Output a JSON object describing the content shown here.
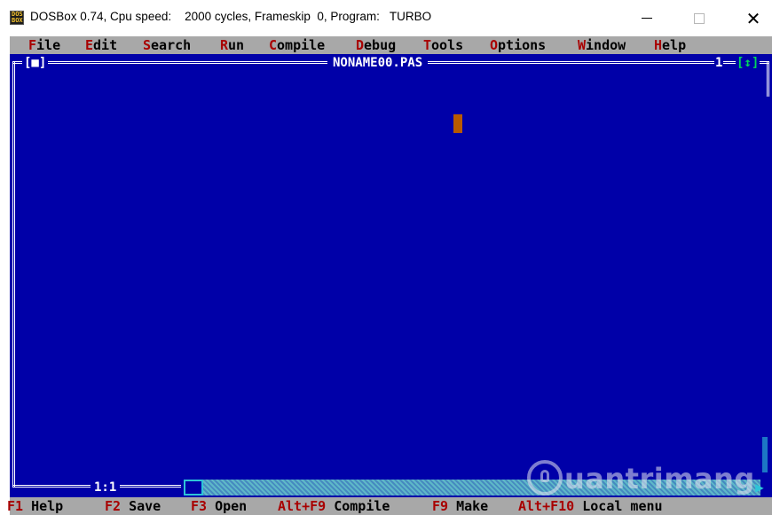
{
  "window": {
    "title": "DOSBox 0.74, Cpu speed:    2000 cycles, Frameskip  0, Program:   TURBO",
    "icon_text": "DOS\nBOX",
    "minimize_icon": "minimize-icon",
    "maximize_icon": "maximize-icon",
    "close_icon": "close-icon",
    "close_glyph": "✕"
  },
  "menu": {
    "items": [
      {
        "hotkey": "F",
        "rest": "ile"
      },
      {
        "hotkey": "E",
        "rest": "dit"
      },
      {
        "hotkey": "S",
        "rest": "earch"
      },
      {
        "hotkey": "R",
        "rest": "un"
      },
      {
        "hotkey": "C",
        "rest": "ompile"
      },
      {
        "hotkey": "D",
        "rest": "ebug"
      },
      {
        "hotkey": "T",
        "rest": "ools"
      },
      {
        "hotkey": "O",
        "rest": "ptions"
      },
      {
        "hotkey": "W",
        "rest": "indow"
      },
      {
        "hotkey": "H",
        "rest": "elp"
      }
    ]
  },
  "editor": {
    "close_box": "[■]",
    "filename": "NONAME00.PAS",
    "window_number": "1",
    "zoom_box": "[↕]",
    "cursor_position": "1:1"
  },
  "status": {
    "items": [
      {
        "key": "F1",
        "label": "Help"
      },
      {
        "key": "F2",
        "label": "Save"
      },
      {
        "key": "F3",
        "label": "Open"
      },
      {
        "key": "Alt+F9",
        "label": "Compile"
      },
      {
        "key": "F9",
        "label": "Make"
      },
      {
        "key": "Alt+F10",
        "label": "Local menu"
      }
    ]
  },
  "watermark": {
    "text": "uantrimang"
  },
  "colors": {
    "dos_blue": "#0000a8",
    "dos_gray": "#a8a8a8",
    "hotkey_red": "#a80000",
    "cursor_orange": "#b85a00",
    "scroll_cyan": "#5eb8c8"
  }
}
